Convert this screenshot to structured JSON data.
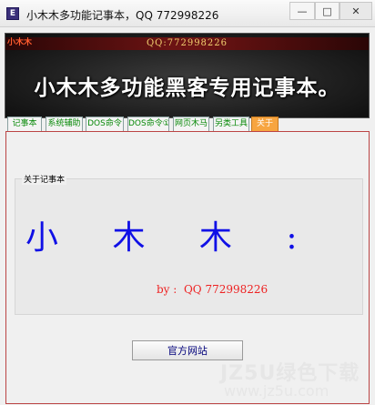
{
  "window": {
    "title": "小木木多功能记事本，QQ 772998226",
    "app_icon": "app-icon",
    "controls": {
      "minimize": "—",
      "maximize": "□",
      "close": "✕"
    }
  },
  "banner": {
    "corner_text": "小木木",
    "qq_text": "QQ:772998226",
    "main_text": "小木木多功能黑客专用记事本。"
  },
  "tabs": [
    {
      "label": "记事本"
    },
    {
      "label": "系统辅助"
    },
    {
      "label": "DOS命令"
    },
    {
      "label": "DOS命令①"
    },
    {
      "label": "网页木马"
    },
    {
      "label": "另类工具"
    },
    {
      "label": "关于",
      "active": true
    }
  ],
  "about": {
    "group_label": "关于记事本",
    "name_text": "小 木 木 :",
    "by_text": "by :  QQ 772998226"
  },
  "official_site_button": "官方网站",
  "watermark": {
    "main": "JZ5U绿色下载",
    "url": "www.jz5u.com"
  },
  "colors": {
    "name_blue": "#1010e6",
    "by_red": "#ee2222",
    "active_tab": "#f7a540",
    "tab_text_green": "#0a8a0a"
  }
}
